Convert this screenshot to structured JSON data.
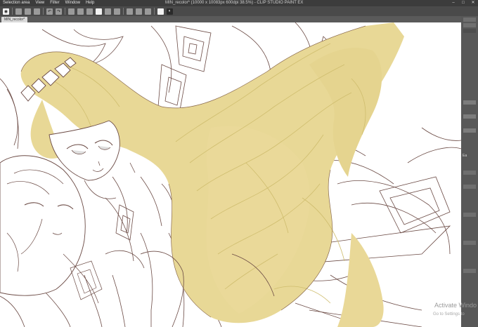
{
  "menu": [
    "Selection area",
    "View",
    "Filter",
    "Window",
    "Help"
  ],
  "window_title": "MIN_recolor* (10000 x 10083px 600dpi 38.5%) - CLIP STUDIO PAINT EX",
  "document_tab": "MIN_recolor*",
  "window_controls": [
    "minimize-icon",
    "maximize-icon",
    "close-icon"
  ],
  "right_panel_label": "Ea",
  "watermark": {
    "line1": "Activate Windo",
    "line2": "Go to Settings to"
  },
  "colors": {
    "hair": "#e8d896",
    "hair_shadow": "#d4c478",
    "lineart": "#6b4a44",
    "canvas": "#ffffff"
  }
}
